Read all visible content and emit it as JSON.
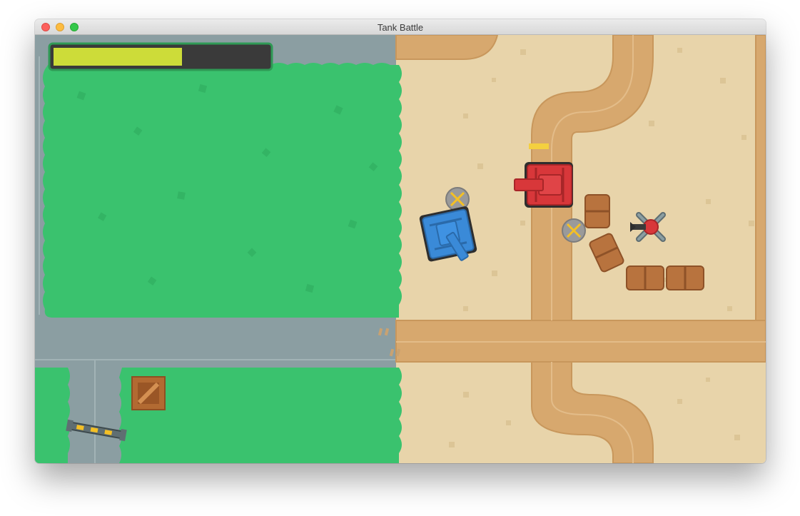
{
  "window": {
    "title": "Tank Battle"
  },
  "hud": {
    "health_fraction": 0.6,
    "fill_color": "#cddc39",
    "track_color": "#3a3a3a",
    "frame_color": "#2f9a55"
  },
  "colors": {
    "grass": "#3ac26e",
    "sand": "#e8d4aa",
    "asphalt": "#8b9ea2",
    "dirt": "#d7a86e",
    "player_tank": "#3a8ad8",
    "enemy_tank": "#d8373a",
    "barrel": "#b8733e",
    "crate": "#b26a32"
  },
  "icons": {
    "player": "blue-tank-icon",
    "enemy": "red-tank-icon",
    "turret": "enemy-turret-icon",
    "crate": "wooden-crate-icon",
    "barrier": "road-barrier-icon",
    "mine": "landmine-icon"
  }
}
